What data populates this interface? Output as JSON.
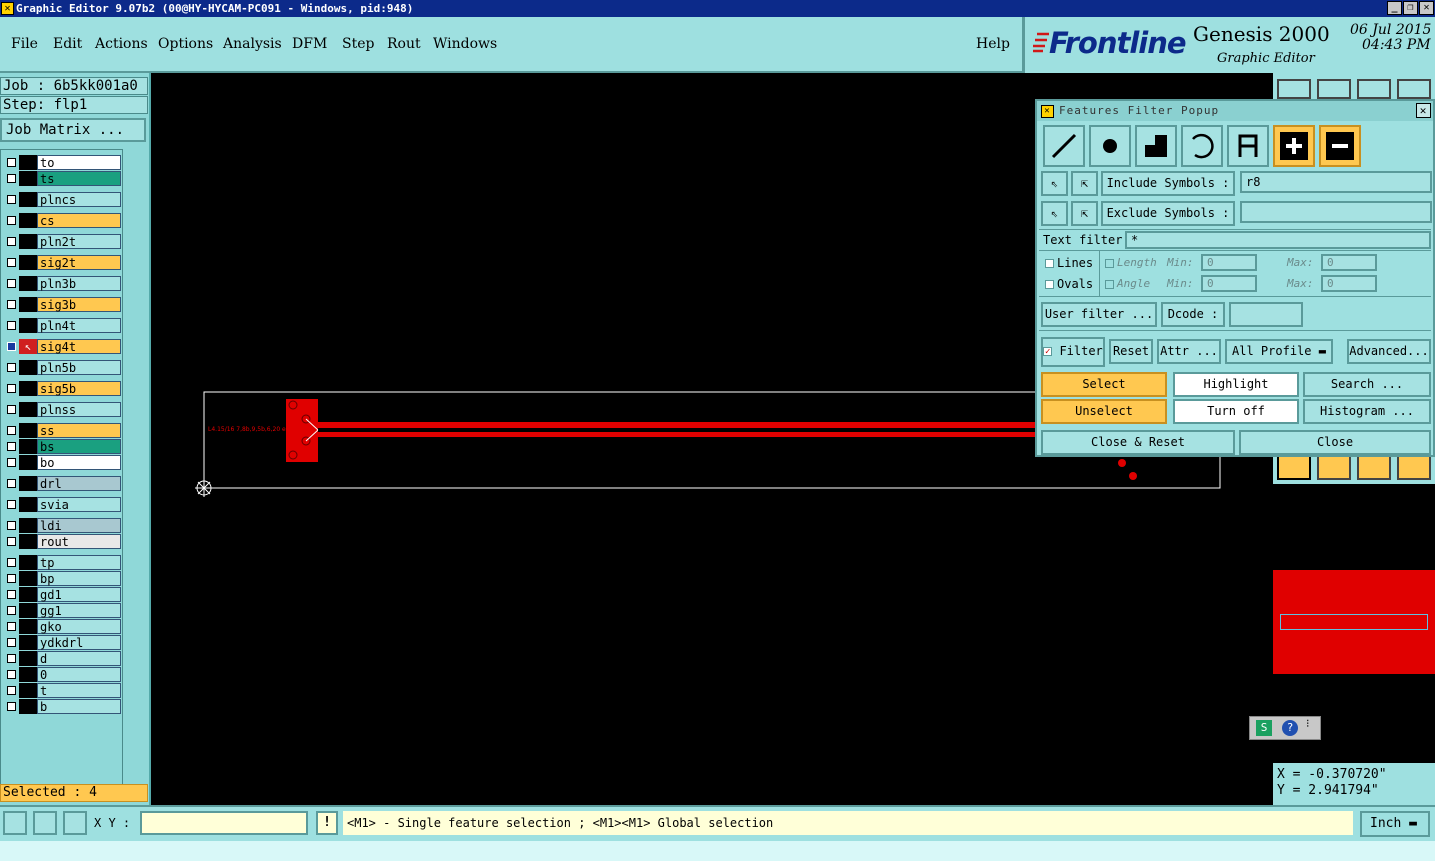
{
  "window": {
    "title": "Graphic Editor 9.07b2 (00@HY-HYCAM-PC091 - Windows, pid:948)"
  },
  "menu": [
    "File",
    "Edit",
    "Actions",
    "Options",
    "Analysis",
    "DFM",
    "Step",
    "Rout",
    "Windows",
    "Help"
  ],
  "brand": {
    "logo": "Frontline",
    "product": "Genesis 2000",
    "subtitle": "Graphic Editor",
    "date": "06 Jul 2015",
    "time": "04:43 PM"
  },
  "left": {
    "job": "Job : 6b5kk001a0",
    "step": "Step: flp1",
    "job_matrix": "Job Matrix ...",
    "layers": [
      {
        "name": "to",
        "color": "#ffffff"
      },
      {
        "name": "ts",
        "color": "#1aa080"
      },
      {
        "name": "plncs",
        "color": "#a6e2e2"
      },
      {
        "name": "cs",
        "color": "#ffc850"
      },
      {
        "name": "pln2t",
        "color": "#a6e2e2"
      },
      {
        "name": "sig2t",
        "color": "#ffc850"
      },
      {
        "name": "pln3b",
        "color": "#a6e2e2"
      },
      {
        "name": "sig3b",
        "color": "#ffc850"
      },
      {
        "name": "pln4t",
        "color": "#a6e2e2"
      },
      {
        "name": "sig4t",
        "color": "#ffc850"
      },
      {
        "name": "pln5b",
        "color": "#a6e2e2"
      },
      {
        "name": "sig5b",
        "color": "#ffc850"
      },
      {
        "name": "plnss",
        "color": "#a6e2e2"
      },
      {
        "name": "ss",
        "color": "#ffc850"
      },
      {
        "name": "bs",
        "color": "#1aa080"
      },
      {
        "name": "bo",
        "color": "#ffffff"
      },
      {
        "name": "drl",
        "color": "#a8c8d0"
      },
      {
        "name": "svia",
        "color": "#a6e2e2"
      },
      {
        "name": "ldi",
        "color": "#a8c8d0"
      },
      {
        "name": "rout",
        "color": "#e8e8e8"
      },
      {
        "name": "tp",
        "color": "#a6e2e2"
      },
      {
        "name": "bp",
        "color": "#a6e2e2"
      },
      {
        "name": "gd1",
        "color": "#a6e2e2"
      },
      {
        "name": "gg1",
        "color": "#a6e2e2"
      },
      {
        "name": "gko",
        "color": "#a6e2e2"
      },
      {
        "name": "ydkdrl",
        "color": "#a6e2e2"
      },
      {
        "name": "d",
        "color": "#a6e2e2"
      },
      {
        "name": "0",
        "color": "#a6e2e2"
      },
      {
        "name": "t",
        "color": "#a6e2e2"
      },
      {
        "name": "b",
        "color": "#a6e2e2"
      }
    ],
    "selected": "Selected : 4"
  },
  "popup": {
    "title": "Features Filter Popup",
    "include_label": "Include Symbols :",
    "include_value": "r8",
    "exclude_label": "Exclude Symbols :",
    "exclude_value": "",
    "text_filter_label": "Text filter",
    "text_filter_value": "*",
    "lines": "Lines",
    "ovals": "Ovals",
    "length": "Length",
    "angle": "Angle",
    "min": "Min:",
    "max": "Max:",
    "len_min": "0",
    "len_max": "0",
    "ang_min": "0",
    "ang_max": "0",
    "user_filter": "User filter ...",
    "dcode": "Dcode :",
    "filter": "Filter",
    "reset": "Reset",
    "attr": "Attr ...",
    "all_profile": "All Profile",
    "advanced": "Advanced...",
    "select": "Select",
    "highlight": "Highlight",
    "search": "Search ...",
    "unselect": "Unselect",
    "turn_off": "Turn off",
    "histogram": "Histogram ...",
    "close_reset": "Close & Reset",
    "close": "Close"
  },
  "coords": {
    "x": "X = -0.370720\"",
    "y": "Y = 2.941794\""
  },
  "status": {
    "xy_label": "X Y :",
    "xy_value": "",
    "message": "<M1> - Single feature selection ; <M1><M1> Global selection",
    "units": "Inch"
  },
  "canvas": {
    "label_text": "L4.15/16 7,8b,9,5b,6,20 e"
  }
}
